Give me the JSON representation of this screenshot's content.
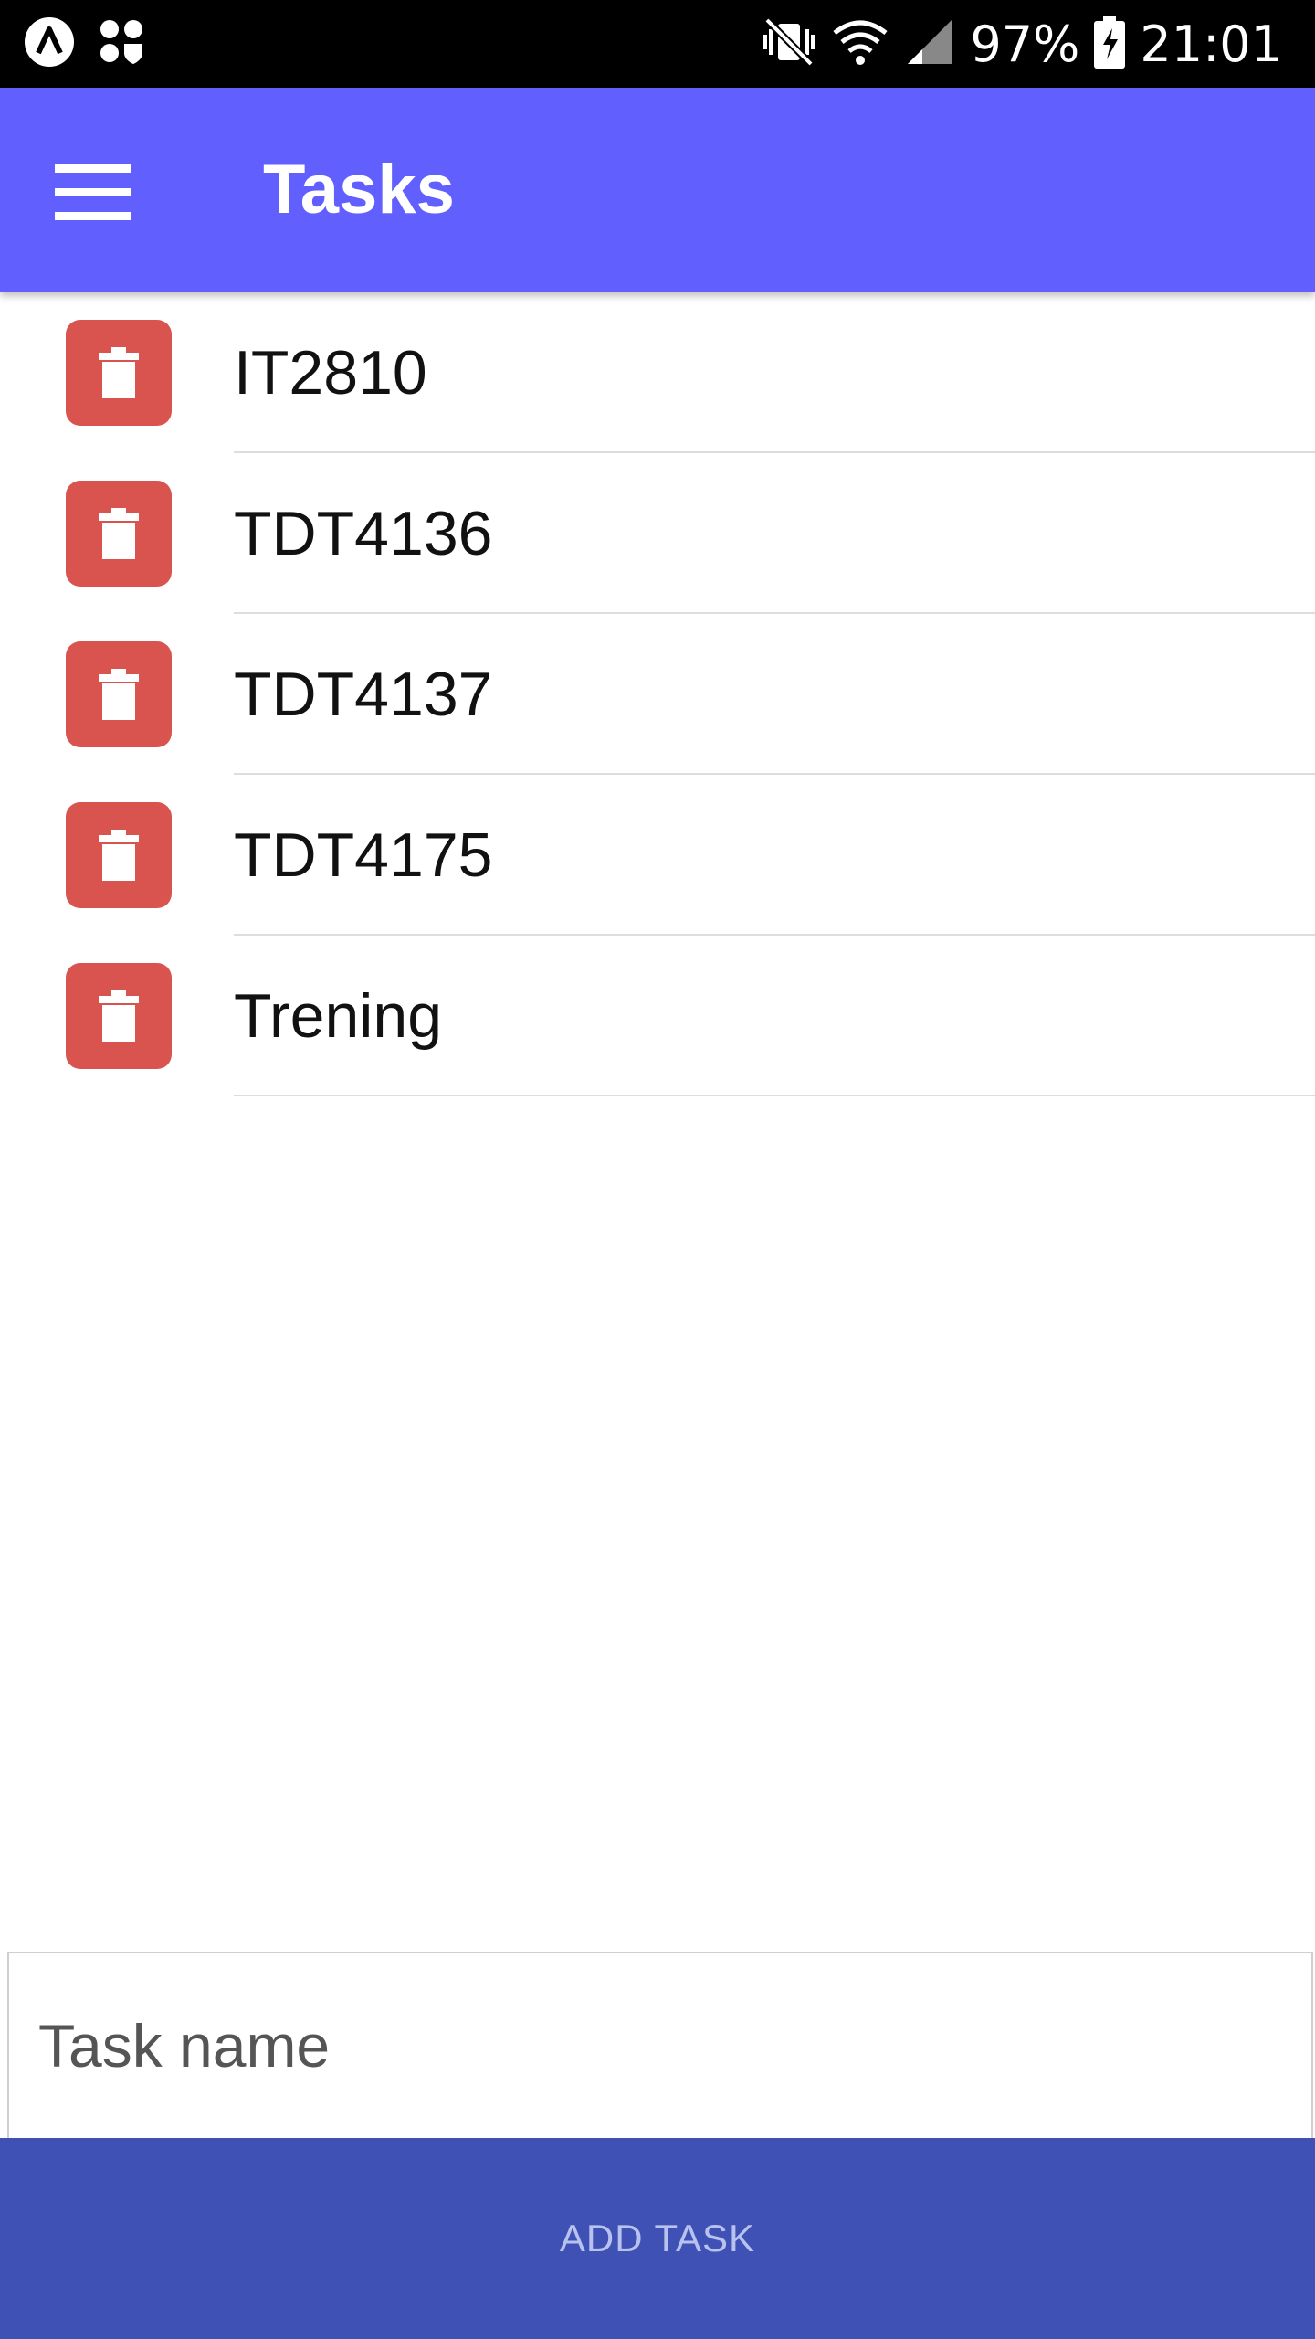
{
  "status_bar": {
    "battery_percent": "97%",
    "time": "21:01",
    "icons": [
      "app-notification-icon",
      "apps-shield-icon",
      "vibrate-mute-icon",
      "wifi-icon",
      "signal-icon",
      "battery-charging-icon"
    ]
  },
  "app_bar": {
    "title": "Tasks",
    "menu_icon": "hamburger-menu-icon",
    "color": "#6160ff"
  },
  "tasks": [
    {
      "label": "IT2810",
      "delete_icon": "trash-icon"
    },
    {
      "label": "TDT4136",
      "delete_icon": "trash-icon"
    },
    {
      "label": "TDT4137",
      "delete_icon": "trash-icon"
    },
    {
      "label": "TDT4175",
      "delete_icon": "trash-icon"
    },
    {
      "label": "Trening",
      "delete_icon": "trash-icon"
    }
  ],
  "task_input": {
    "placeholder": "Task name",
    "value": ""
  },
  "add_button": {
    "label": "ADD TASK",
    "color": "#3f51b5"
  },
  "colors": {
    "delete_button": "#d9534f"
  }
}
